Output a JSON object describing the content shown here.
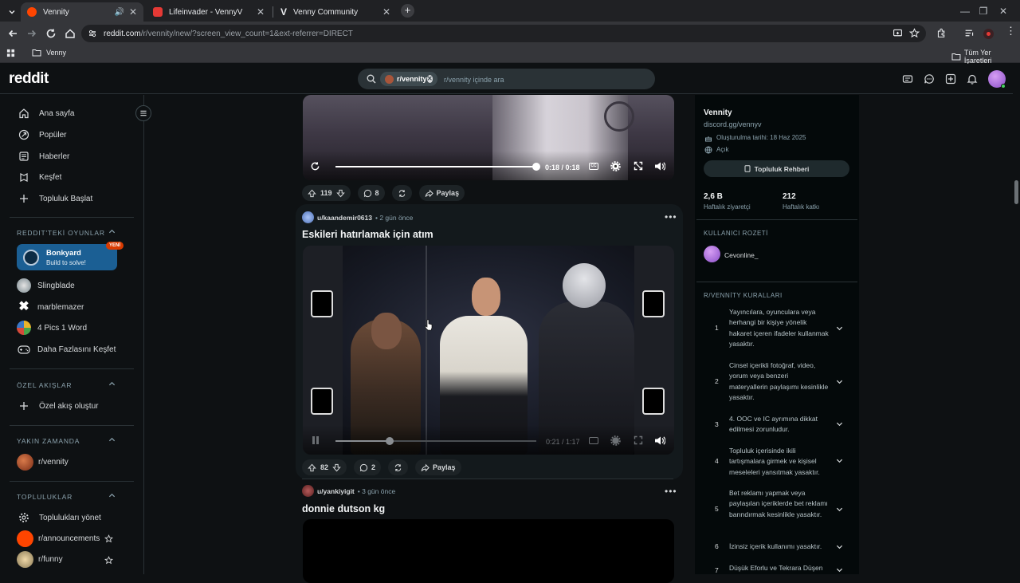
{
  "browser": {
    "tabs": [
      {
        "title": "Vennity",
        "fav_color": "#ff4500"
      },
      {
        "title": "Lifeinvader - VennyV",
        "fav_color": "#e53935"
      },
      {
        "title": "Venny Community",
        "fav_color": "#202124"
      }
    ],
    "url_host": "reddit.com",
    "url_path": "/r/vennity/new/?screen_view_count=1&ext-referrer=DIRECT",
    "bookmark": "Venny",
    "all_bookmarks": "Tüm Yer İşaretleri"
  },
  "header": {
    "logo": "reddit",
    "search_chip": "r/vennity",
    "search_placeholder": "r/vennity içinde ara"
  },
  "sidebar": {
    "nav": [
      {
        "label": "Ana sayfa",
        "icon": "home-icon"
      },
      {
        "label": "Popüler",
        "icon": "popular-icon"
      },
      {
        "label": "Haberler",
        "icon": "news-icon"
      },
      {
        "label": "Keşfet",
        "icon": "explore-icon"
      },
      {
        "label": "Topluluk Başlat",
        "icon": "plus-icon"
      }
    ],
    "games_heading": "REDDIT'TEKİ OYUNLAR",
    "featured_game": {
      "name": "Bonkyard",
      "sub": "Build to solve!",
      "badge": "YENİ"
    },
    "games": [
      "Slingblade",
      "marblemazer",
      "4 Pics 1 Word",
      "Daha Fazlasını Keşfet"
    ],
    "custom_heading": "ÖZEL AKIŞLAR",
    "custom_create": "Özel akış oluştur",
    "recent_heading": "YAKIN ZAMANDA",
    "recent": [
      "r/vennity"
    ],
    "communities_heading": "TOPLULUKLAR",
    "communities": [
      "Toplulukları yönet",
      "r/announcements",
      "r/funny"
    ]
  },
  "posts": [
    {
      "video_time": "0:18 / 0:18",
      "progress": 1.0,
      "votes": "119",
      "comments": "8",
      "share": "Paylaş"
    },
    {
      "user": "u/kaandemir0613",
      "time": "• 2 gün önce",
      "title": "Eskileri hatırlamak için atım",
      "video_time": "0:21 / 1:17",
      "progress": 0.27,
      "votes": "82",
      "comments": "2",
      "share": "Paylaş"
    },
    {
      "user": "u/yankiyigit",
      "time": "• 3 gün önce",
      "title": "donnie dutson kg"
    }
  ],
  "community": {
    "name": "Vennity",
    "link": "discord.gg/vennyv",
    "created": "Oluşturulma tarihi: 18 Haz 2025",
    "status": "Açık",
    "guide_button": "Topluluk Rehberi",
    "stats": [
      {
        "value": "2,6 B",
        "label": "Haftalık ziyaretçi"
      },
      {
        "value": "212",
        "label": "Haftalık katkı"
      }
    ],
    "badge_heading": "KULLANICI ROZETİ",
    "badge_user": "Cevonline_",
    "rules_heading": "R/VENNİTY KURALLARI",
    "rules": [
      {
        "n": "1",
        "text": "Yayıncılara, oyunculara veya herhangi bir kişiye yönelik hakaret içeren ifadeler kullanmak yasaktır."
      },
      {
        "n": "2",
        "text": "Cinsel içerikli fotoğraf, video, yorum veya benzeri materyallerin paylaşımı kesinlikle yasaktır."
      },
      {
        "n": "3",
        "text": "4. OOC ve IC ayrımına dikkat edilmesi zorunludur."
      },
      {
        "n": "4",
        "text": "Topluluk içerisinde ikili tartışmalara girmek ve kişisel meseleleri yansıtmak yasaktır."
      },
      {
        "n": "5",
        "text": "Bet reklamı yapmak veya paylaşılan içeriklerde bet reklamı barındırmak kesinlikle yasaktır."
      },
      {
        "n": "6",
        "text": "İzinsiz içerik kullanımı yasaktır."
      },
      {
        "n": "7",
        "text": "Düşük Eforlu ve Tekrara Düşen"
      }
    ]
  }
}
